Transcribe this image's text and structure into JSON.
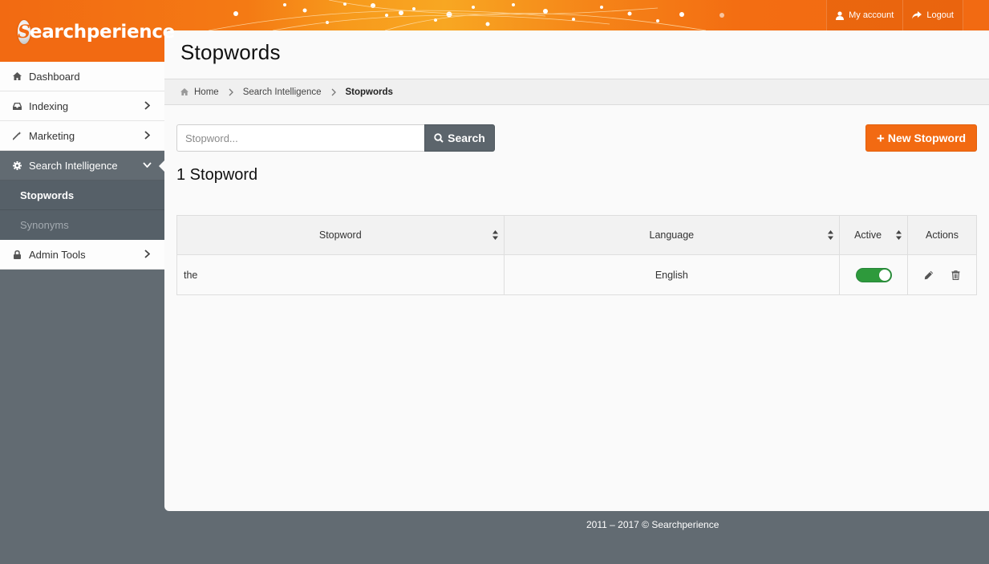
{
  "brand": {
    "name": "Searchperience",
    "logo_letter": "S",
    "logo_rest": "earchperience"
  },
  "header": {
    "my_account": "My account",
    "logout": "Logout"
  },
  "sidebar": {
    "items": [
      {
        "label": "Dashboard",
        "icon": "home-icon"
      },
      {
        "label": "Indexing",
        "icon": "inbox-icon"
      },
      {
        "label": "Marketing",
        "icon": "wand-icon"
      },
      {
        "label": "Search Intelligence",
        "icon": "gear-icon"
      },
      {
        "label": "Admin Tools",
        "icon": "lock-icon"
      }
    ],
    "sub_items": [
      {
        "label": "Stopwords"
      },
      {
        "label": "Synonyms"
      }
    ]
  },
  "page": {
    "title": "Stopwords"
  },
  "breadcrumb": [
    "Home",
    "Search Intelligence",
    "Stopwords"
  ],
  "search": {
    "placeholder": "Stopword...",
    "value": "",
    "button": "Search"
  },
  "new_button": "New Stopword",
  "count_heading": "1 Stopword",
  "table": {
    "headers": [
      "Stopword",
      "Language",
      "Active",
      "Actions"
    ],
    "rows": [
      {
        "stopword": "the",
        "language": "English",
        "active": true
      }
    ]
  },
  "footer": "2011 – 2017 © Searchperience",
  "colors": {
    "accent": "#f26a12",
    "sidebar_dark": "#626b72",
    "toggle_on": "#2e9a3c"
  }
}
